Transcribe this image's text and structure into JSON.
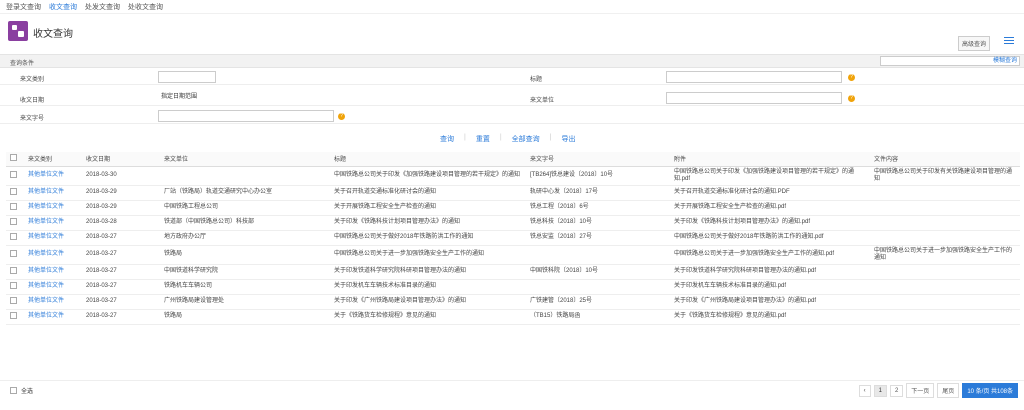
{
  "topnav": [
    "登录文查询",
    "收文查询",
    "处发文查询",
    "处收文查询"
  ],
  "title": "收文查询",
  "adv_search": "高级查询",
  "cond": {
    "title": "查询条件",
    "select_value": "模糊查询"
  },
  "form": {
    "type_label": "来文类别",
    "title_label": "标题",
    "date_label": "收文日期",
    "date_value": "指定日期范围",
    "unit_label": "来文单位",
    "number_label": "来文字号"
  },
  "actions": [
    "查询",
    "重置",
    "全部查询",
    "导出"
  ],
  "table": {
    "headers": [
      "来文类别",
      "收文日期",
      "来文单位",
      "标题",
      "来文字号",
      "附件",
      "文件内容"
    ],
    "rows": [
      [
        "其他单位文件",
        "2018-03-30",
        "",
        "中国铁路总公司关于印发《加强铁路建设项目管理的若干规定》的通知",
        "[TB264]铁总建设〔2018〕10号",
        "中国铁路总公司关于印发《加强铁路建设项目管理的若干规定》的通知.pdf",
        "中国铁路总公司关于印发有关铁路建设项目管理的通知"
      ],
      [
        "其他单位文件",
        "2018-03-29",
        "厂站（铁路局）轨道交通研究中心办公室",
        "关于召开轨道交通标准化研讨会的通知",
        "轨研中心发〔2018〕17号",
        "关于召开轨道交通标准化研讨会的通知.PDF",
        ""
      ],
      [
        "其他单位文件",
        "2018-03-29",
        "中国铁路工程总公司",
        "关于开展铁路工程安全生产检查的通知",
        "铁总工程〔2018〕6号",
        "关于开展铁路工程安全生产检查的通知.pdf",
        ""
      ],
      [
        "其他单位文件",
        "2018-03-28",
        "铁道部（中国铁路总公司）科技部",
        "关于印发《铁路科技计划项目管理办法》的通知",
        "铁总科技〔2018〕10号",
        "关于印发《铁路科技计划项目管理办法》的通知.pdf",
        ""
      ],
      [
        "其他单位文件",
        "2018-03-27",
        "地方政府办公厅",
        "中国铁路总公司关于做好2018年铁路防洪工作的通知",
        "铁总安监〔2018〕27号",
        "中国铁路总公司关于做好2018年铁路防洪工作的通知.pdf",
        ""
      ],
      [
        "其他单位文件",
        "2018-03-27",
        "铁路局",
        "中国铁路总公司关于进一步加强铁路安全生产工作的通知",
        "",
        "中国铁路总公司关于进一步加强铁路安全生产工作的通知.pdf",
        "中国铁路总公司关于进一步加强铁路安全生产工作的通知"
      ],
      [
        "其他单位文件",
        "2018-03-27",
        "中国铁道科学研究院",
        "关于印发铁道科学研究院科研项目管理办法的通知",
        "中国铁科院〔2018〕10号",
        "关于印发铁道科学研究院科研项目管理办法的通知.pdf",
        ""
      ],
      [
        "其他单位文件",
        "2018-03-27",
        "铁路机车车辆公司",
        "关于印发机车车辆技术标准目录的通知",
        "",
        "关于印发机车车辆技术标准目录的通知.pdf",
        ""
      ],
      [
        "其他单位文件",
        "2018-03-27",
        "广州铁路局建设管理处",
        "关于印发《广州铁路局建设项目管理办法》的通知",
        "广铁建管〔2018〕25号",
        "关于印发《广州铁路局建设项目管理办法》的通知.pdf",
        ""
      ],
      [
        "其他单位文件",
        "2018-03-27",
        "铁路局",
        "关于《铁路货车检修规程》意见的通知",
        "（TB15）铁路局函",
        "关于《铁路货车检修规程》意见的通知.pdf",
        ""
      ]
    ]
  },
  "footer": {
    "select_all": "全选",
    "pages": [
      "‹",
      "1",
      "2",
      "下一页",
      "尾页"
    ],
    "page_size": "10 条/页 共108条"
  }
}
